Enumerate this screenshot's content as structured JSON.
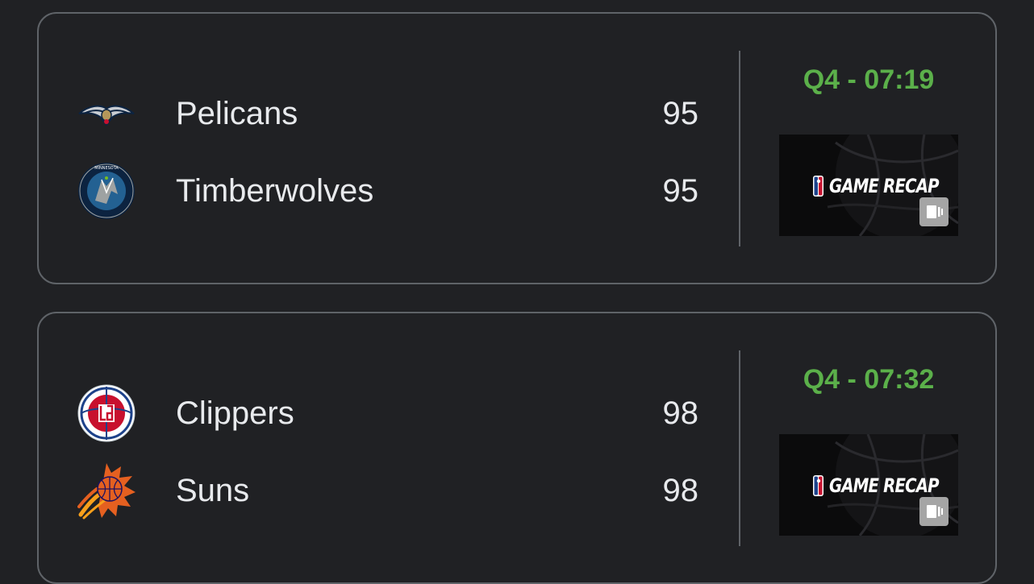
{
  "games": [
    {
      "status": "Q4 - 07:19",
      "recap_label": "GAME RECAP",
      "teams": [
        {
          "name": "Pelicans",
          "score": "95",
          "logo": "pelicans-logo"
        },
        {
          "name": "Timberwolves",
          "score": "95",
          "logo": "timberwolves-logo"
        }
      ]
    },
    {
      "status": "Q4 - 07:32",
      "recap_label": "GAME RECAP",
      "teams": [
        {
          "name": "Clippers",
          "score": "98",
          "logo": "clippers-logo"
        },
        {
          "name": "Suns",
          "score": "98",
          "logo": "suns-logo"
        }
      ]
    }
  ],
  "colors": {
    "background": "#202124",
    "card_border": "#5f6368",
    "text": "#e8eaed",
    "status_live": "#5bb04a"
  }
}
